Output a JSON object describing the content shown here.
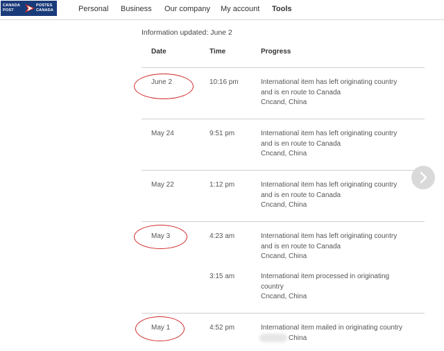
{
  "header": {
    "logo": {
      "line1_left": "CANADA",
      "line2_left": "POST",
      "line1_right": "POSTES",
      "line2_right": "CANADA",
      "color": "#1a3b7a",
      "accent": "#d52b1e"
    },
    "nav": [
      {
        "label": "Personal"
      },
      {
        "label": "Business"
      },
      {
        "label": "Our company"
      },
      {
        "label": "My account"
      },
      {
        "label": "Tools"
      }
    ]
  },
  "tracking": {
    "updated": "Information updated: June 2",
    "columns": {
      "date": "Date",
      "time": "Time",
      "progress": "Progress"
    },
    "rows": [
      {
        "date": "June 2",
        "time": "10:16 pm",
        "progress": [
          "International item has left originating country",
          "and is en route to Canada",
          "Cncand, China"
        ]
      },
      {
        "date": "May 24",
        "time": "9:51 pm",
        "progress": [
          "International item has left originating country",
          "and is en route to Canada",
          "Cncand, China"
        ]
      },
      {
        "date": "May 22",
        "time": "1:12 pm",
        "progress": [
          "International item has left originating country",
          "and is en route to Canada",
          "Cncand, China"
        ]
      },
      {
        "date": "May 3",
        "time": "4:23 am",
        "progress": [
          "International item has left originating country",
          "and is en route to Canada",
          "Cncand, China"
        ]
      },
      {
        "date": "",
        "time": "3:15 am",
        "progress": [
          "International item processed in originating",
          "country",
          "Cncand, China"
        ]
      },
      {
        "date": "May 1",
        "time": "4:52 pm",
        "progress": [
          "International item mailed in originating country",
          "China"
        ]
      }
    ]
  },
  "annotation_color": "#d02929",
  "icons": {
    "next": "chevron-right-icon"
  }
}
